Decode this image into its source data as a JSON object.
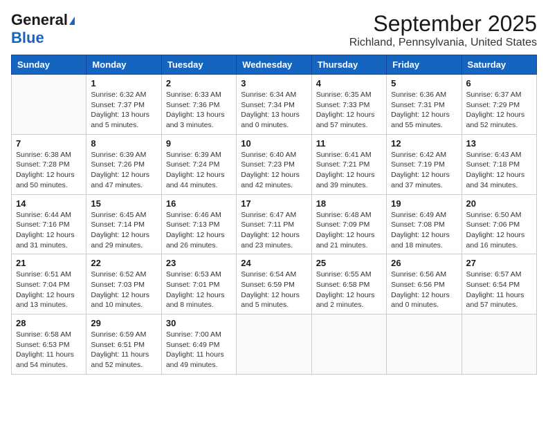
{
  "header": {
    "logo_general": "General",
    "logo_blue": "Blue",
    "month_title": "September 2025",
    "location": "Richland, Pennsylvania, United States"
  },
  "weekdays": [
    "Sunday",
    "Monday",
    "Tuesday",
    "Wednesday",
    "Thursday",
    "Friday",
    "Saturday"
  ],
  "weeks": [
    [
      {
        "day": "",
        "info": ""
      },
      {
        "day": "1",
        "info": "Sunrise: 6:32 AM\nSunset: 7:37 PM\nDaylight: 13 hours\nand 5 minutes."
      },
      {
        "day": "2",
        "info": "Sunrise: 6:33 AM\nSunset: 7:36 PM\nDaylight: 13 hours\nand 3 minutes."
      },
      {
        "day": "3",
        "info": "Sunrise: 6:34 AM\nSunset: 7:34 PM\nDaylight: 13 hours\nand 0 minutes."
      },
      {
        "day": "4",
        "info": "Sunrise: 6:35 AM\nSunset: 7:33 PM\nDaylight: 12 hours\nand 57 minutes."
      },
      {
        "day": "5",
        "info": "Sunrise: 6:36 AM\nSunset: 7:31 PM\nDaylight: 12 hours\nand 55 minutes."
      },
      {
        "day": "6",
        "info": "Sunrise: 6:37 AM\nSunset: 7:29 PM\nDaylight: 12 hours\nand 52 minutes."
      }
    ],
    [
      {
        "day": "7",
        "info": "Sunrise: 6:38 AM\nSunset: 7:28 PM\nDaylight: 12 hours\nand 50 minutes."
      },
      {
        "day": "8",
        "info": "Sunrise: 6:39 AM\nSunset: 7:26 PM\nDaylight: 12 hours\nand 47 minutes."
      },
      {
        "day": "9",
        "info": "Sunrise: 6:39 AM\nSunset: 7:24 PM\nDaylight: 12 hours\nand 44 minutes."
      },
      {
        "day": "10",
        "info": "Sunrise: 6:40 AM\nSunset: 7:23 PM\nDaylight: 12 hours\nand 42 minutes."
      },
      {
        "day": "11",
        "info": "Sunrise: 6:41 AM\nSunset: 7:21 PM\nDaylight: 12 hours\nand 39 minutes."
      },
      {
        "day": "12",
        "info": "Sunrise: 6:42 AM\nSunset: 7:19 PM\nDaylight: 12 hours\nand 37 minutes."
      },
      {
        "day": "13",
        "info": "Sunrise: 6:43 AM\nSunset: 7:18 PM\nDaylight: 12 hours\nand 34 minutes."
      }
    ],
    [
      {
        "day": "14",
        "info": "Sunrise: 6:44 AM\nSunset: 7:16 PM\nDaylight: 12 hours\nand 31 minutes."
      },
      {
        "day": "15",
        "info": "Sunrise: 6:45 AM\nSunset: 7:14 PM\nDaylight: 12 hours\nand 29 minutes."
      },
      {
        "day": "16",
        "info": "Sunrise: 6:46 AM\nSunset: 7:13 PM\nDaylight: 12 hours\nand 26 minutes."
      },
      {
        "day": "17",
        "info": "Sunrise: 6:47 AM\nSunset: 7:11 PM\nDaylight: 12 hours\nand 23 minutes."
      },
      {
        "day": "18",
        "info": "Sunrise: 6:48 AM\nSunset: 7:09 PM\nDaylight: 12 hours\nand 21 minutes."
      },
      {
        "day": "19",
        "info": "Sunrise: 6:49 AM\nSunset: 7:08 PM\nDaylight: 12 hours\nand 18 minutes."
      },
      {
        "day": "20",
        "info": "Sunrise: 6:50 AM\nSunset: 7:06 PM\nDaylight: 12 hours\nand 16 minutes."
      }
    ],
    [
      {
        "day": "21",
        "info": "Sunrise: 6:51 AM\nSunset: 7:04 PM\nDaylight: 12 hours\nand 13 minutes."
      },
      {
        "day": "22",
        "info": "Sunrise: 6:52 AM\nSunset: 7:03 PM\nDaylight: 12 hours\nand 10 minutes."
      },
      {
        "day": "23",
        "info": "Sunrise: 6:53 AM\nSunset: 7:01 PM\nDaylight: 12 hours\nand 8 minutes."
      },
      {
        "day": "24",
        "info": "Sunrise: 6:54 AM\nSunset: 6:59 PM\nDaylight: 12 hours\nand 5 minutes."
      },
      {
        "day": "25",
        "info": "Sunrise: 6:55 AM\nSunset: 6:58 PM\nDaylight: 12 hours\nand 2 minutes."
      },
      {
        "day": "26",
        "info": "Sunrise: 6:56 AM\nSunset: 6:56 PM\nDaylight: 12 hours\nand 0 minutes."
      },
      {
        "day": "27",
        "info": "Sunrise: 6:57 AM\nSunset: 6:54 PM\nDaylight: 11 hours\nand 57 minutes."
      }
    ],
    [
      {
        "day": "28",
        "info": "Sunrise: 6:58 AM\nSunset: 6:53 PM\nDaylight: 11 hours\nand 54 minutes."
      },
      {
        "day": "29",
        "info": "Sunrise: 6:59 AM\nSunset: 6:51 PM\nDaylight: 11 hours\nand 52 minutes."
      },
      {
        "day": "30",
        "info": "Sunrise: 7:00 AM\nSunset: 6:49 PM\nDaylight: 11 hours\nand 49 minutes."
      },
      {
        "day": "",
        "info": ""
      },
      {
        "day": "",
        "info": ""
      },
      {
        "day": "",
        "info": ""
      },
      {
        "day": "",
        "info": ""
      }
    ]
  ]
}
